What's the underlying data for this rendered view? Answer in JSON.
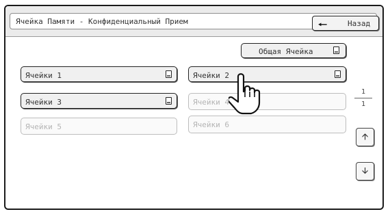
{
  "header": {
    "title": "Ячейка Памяти - Конфиденциальный Прием",
    "back_label": "Назад"
  },
  "common_cell": {
    "label": "Общая Ячейка"
  },
  "cells": [
    {
      "label": "Ячейки 1",
      "enabled": true,
      "has_doc": true
    },
    {
      "label": "Ячейки 2",
      "enabled": true,
      "has_doc": true
    },
    {
      "label": "Ячейки 3",
      "enabled": true,
      "has_doc": true
    },
    {
      "label": "Ячейки 4",
      "enabled": false,
      "has_doc": false
    },
    {
      "label": "Ячейки 5",
      "enabled": false,
      "has_doc": false
    },
    {
      "label": "Ячейки 6",
      "enabled": false,
      "has_doc": false
    }
  ],
  "pager": {
    "current": "1",
    "total": "1"
  },
  "icons": {
    "back": "left-arrow-icon",
    "up": "scroll-up-icon",
    "down": "scroll-down-icon",
    "document": "document-icon",
    "cursor": "hand-pointer-icon"
  }
}
